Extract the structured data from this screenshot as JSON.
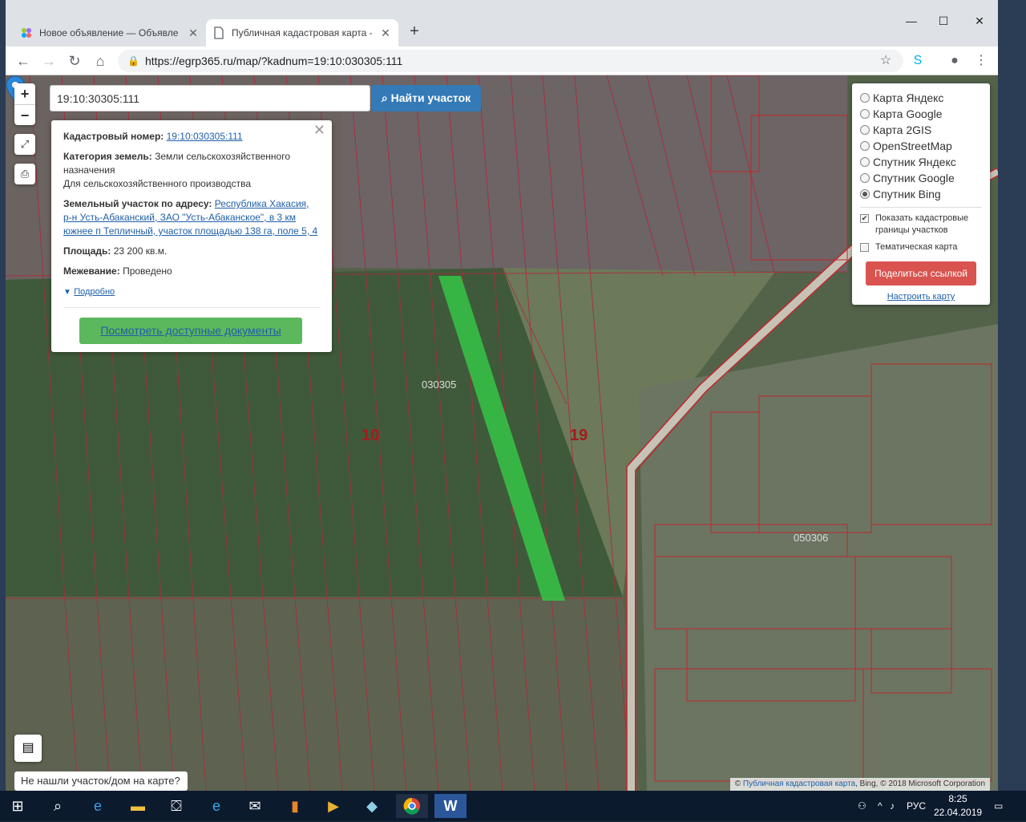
{
  "browser": {
    "tabs": [
      {
        "title": "Новое объявление — Объявле",
        "active": false
      },
      {
        "title": "Публичная кадастровая карта -",
        "active": true
      }
    ],
    "url_host": "https://egrp365.ru",
    "url_path": "/map/?kadnum=19:10:030305:111"
  },
  "search": {
    "value": "19:10:30305:111",
    "button_label": "Найти участок"
  },
  "info": {
    "cad_label": "Кадастровый номер:",
    "cad_value": "19:10:030305:111",
    "category_label": "Категория земель:",
    "category_value": "Земли сельскохозяйственного назначения",
    "category_use": "Для сельскохозяйственного производства",
    "address_label": "Земельный участок по адресу:",
    "address_value": "Республика Хакасия, р-н Усть-Абаканский, ЗАО \"Усть-Абаканское\", в 3 км южнее п Тепличный, участок площадью 138 га, поле 5, 4",
    "area_label": "Площадь:",
    "area_value": "23 200 кв.м.",
    "survey_label": "Межевание:",
    "survey_value": "Проведено",
    "more_label": "Подробно",
    "docs_button": "Посмотреть доступные документы"
  },
  "layers": {
    "options": [
      {
        "label": "Карта Яндекс",
        "selected": false
      },
      {
        "label": "Карта Google",
        "selected": false
      },
      {
        "label": "Карта 2GIS",
        "selected": false
      },
      {
        "label": "OpenStreetMap",
        "selected": false
      },
      {
        "label": "Спутник Яндекс",
        "selected": false
      },
      {
        "label": "Спутник Google",
        "selected": false
      },
      {
        "label": "Спутник Bing",
        "selected": true
      }
    ],
    "show_borders_label": "Показать кадастровые границы участков",
    "show_borders_checked": true,
    "thematic_label": "Тематическая карта",
    "thematic_checked": false,
    "share_button": "Поделиться ссылкой",
    "configure_link": "Настроить карту"
  },
  "map": {
    "quarter_left": "030305",
    "quarter_right": "050306",
    "district_10": "10",
    "district_19": "19",
    "not_found": "Не нашли участок/дом на карте?",
    "attribution_link": "Публичная кадастровая карта",
    "attribution_rest": ", Bing, © 2018 Microsoft Corporation"
  },
  "taskbar": {
    "lang": "РУС",
    "time": "8:25",
    "date": "22.04.2019"
  },
  "colors": {
    "highlight": "#35c548",
    "border_red": "#c0282a",
    "search_blue": "#337ab7",
    "docs_green": "#5cb85c",
    "share_red": "#d9534f"
  }
}
